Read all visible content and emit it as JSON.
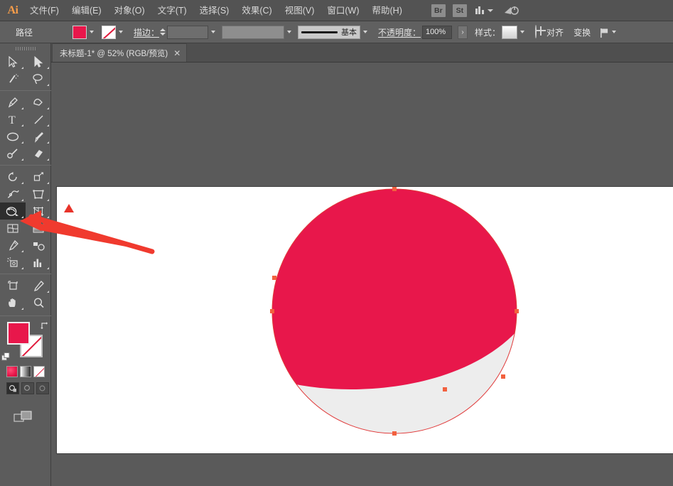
{
  "app": {
    "name": "Ai",
    "logo_color": "#f79d4a"
  },
  "menubar": {
    "items": [
      {
        "label": "文件(F)"
      },
      {
        "label": "编辑(E)"
      },
      {
        "label": "对象(O)"
      },
      {
        "label": "文字(T)"
      },
      {
        "label": "选择(S)"
      },
      {
        "label": "效果(C)"
      },
      {
        "label": "视图(V)"
      },
      {
        "label": "窗口(W)"
      },
      {
        "label": "帮助(H)"
      }
    ],
    "bridge_label": "Br",
    "stock_label": "St",
    "workspace_label": "",
    "power_label": ""
  },
  "optionsbar": {
    "tool_label": "路径",
    "fill_color": "#e8174b",
    "stroke_swatch": "none",
    "stroke_label": "描边：",
    "stroke_weight_value": "",
    "stroke_profile_value": "",
    "brush_name": "基本",
    "opacity_label": "不透明度：",
    "opacity_value": "100%",
    "style_label": "样式：",
    "align_label": "对齐",
    "transform_label": "变换",
    "more_chevron": "›"
  },
  "tabbar": {
    "document_title": "未标题-1* @ 52% (RGB/预览)",
    "close_glyph": "✕"
  },
  "toolbar": {
    "tools": [
      {
        "name": "selection-tool",
        "row": 0,
        "col": 0
      },
      {
        "name": "direct-selection-tool",
        "row": 0,
        "col": 1
      },
      {
        "name": "magic-wand-tool",
        "row": 1,
        "col": 0
      },
      {
        "name": "lasso-tool",
        "row": 1,
        "col": 1
      },
      {
        "name": "pen-tool",
        "row": 2,
        "col": 0
      },
      {
        "name": "curvature-tool",
        "row": 2,
        "col": 1
      },
      {
        "name": "type-tool",
        "row": 3,
        "col": 0
      },
      {
        "name": "line-segment-tool",
        "row": 3,
        "col": 1
      },
      {
        "name": "ellipse-tool",
        "row": 4,
        "col": 0
      },
      {
        "name": "paintbrush-tool",
        "row": 4,
        "col": 1
      },
      {
        "name": "pencil-tool",
        "row": 5,
        "col": 0
      },
      {
        "name": "eraser-tool",
        "row": 5,
        "col": 1
      },
      {
        "name": "rotate-tool",
        "row": 6,
        "col": 0
      },
      {
        "name": "scale-tool",
        "row": 6,
        "col": 1
      },
      {
        "name": "width-tool",
        "row": 7,
        "col": 0
      },
      {
        "name": "free-transform-tool",
        "row": 7,
        "col": 1
      },
      {
        "name": "shape-builder-tool",
        "row": 8,
        "col": 0,
        "selected": true
      },
      {
        "name": "perspective-grid-tool",
        "row": 8,
        "col": 1
      },
      {
        "name": "mesh-tool",
        "row": 9,
        "col": 0
      },
      {
        "name": "gradient-tool",
        "row": 9,
        "col": 1
      },
      {
        "name": "eyedropper-tool",
        "row": 10,
        "col": 0
      },
      {
        "name": "blend-tool",
        "row": 10,
        "col": 1
      },
      {
        "name": "symbol-sprayer-tool",
        "row": 11,
        "col": 0
      },
      {
        "name": "column-graph-tool",
        "row": 11,
        "col": 1
      },
      {
        "name": "artboard-tool",
        "row": 12,
        "col": 0
      },
      {
        "name": "slice-tool",
        "row": 12,
        "col": 1
      },
      {
        "name": "hand-tool",
        "row": 13,
        "col": 0
      },
      {
        "name": "zoom-tool",
        "row": 13,
        "col": 1
      }
    ],
    "fill_color": "#e8174b",
    "stroke_color": "none"
  },
  "canvas": {
    "zoom_percent": "52%",
    "artboard_background": "#ffffff",
    "shape": {
      "name": "circle-split-by-arc",
      "top_fill": "#e8174b",
      "bottom_fill": "#ededed",
      "path_stroke": "#e03a3a",
      "anchor_color": "#f2613f"
    }
  },
  "annotation": {
    "arrow_color": "#f03a2e",
    "marker_color": "#e8332a",
    "arrow_from": "215,355",
    "arrow_to": "30,310"
  }
}
